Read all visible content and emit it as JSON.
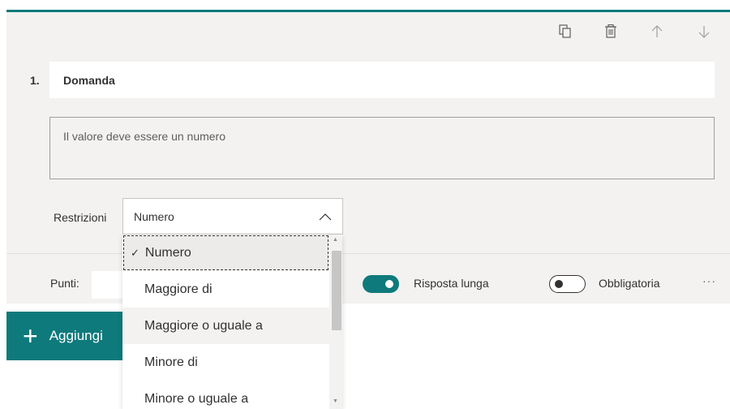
{
  "toolbar": {
    "icons": [
      "copy-icon",
      "delete-icon",
      "arrow-up-icon",
      "arrow-down-icon"
    ]
  },
  "question": {
    "number": "1.",
    "title": "Domanda",
    "answer_placeholder": "Il valore deve essere un numero"
  },
  "restrictions": {
    "label": "Restrizioni",
    "selected": "Numero",
    "options": [
      "Numero",
      "Maggiore di",
      "Maggiore o uguale a",
      "Minore di",
      "Minore o uguale a"
    ]
  },
  "bottom": {
    "points_label": "Punti:",
    "long_answer_label": "Risposta lunga",
    "long_answer_on": true,
    "required_label": "Obbligatoria",
    "required_on": false,
    "more": "···"
  },
  "add_button": {
    "plus": "+",
    "label": "Aggiungi"
  },
  "colors": {
    "accent": "#0e7a7c",
    "card_bg": "#f3f2f1"
  }
}
